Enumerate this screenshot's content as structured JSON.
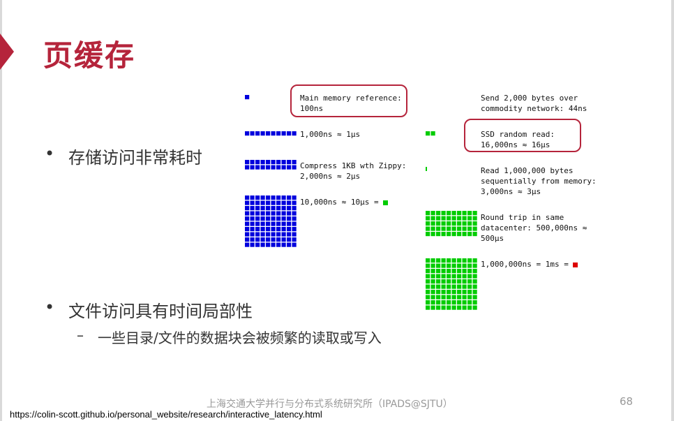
{
  "slide": {
    "title": "页缓存",
    "bullets": [
      {
        "text": "存储访问非常耗时"
      },
      {
        "text": "文件访问具有时间局部性"
      }
    ],
    "sub_bullets": [
      {
        "text": "一些目录/文件的数据块会被频繁的读取或写入"
      }
    ],
    "bullet_marker": "•",
    "dash_marker": "–",
    "footer": "上海交通大学并行与分布式系统研究所（IPADS@SJTU）",
    "page_number": "68",
    "source_url": "https://colin-scott.github.io/personal_website/research/interactive_latency.html"
  },
  "latency": {
    "left_items": [
      {
        "label": "Main memory reference:\n100ns",
        "blue_squares": 1
      },
      {
        "label": "1,000ns ≈ 1μs",
        "blue_squares": 10
      },
      {
        "label": "Compress 1KB wth Zippy:\n2,000ns ≈ 2μs",
        "blue_squares": 20
      },
      {
        "label": "10,000ns ≈ 10μs = ",
        "blue_squares": 100,
        "unit_marker_color": "#00cc00"
      }
    ],
    "right_items": [
      {
        "label": "Send 2,000 bytes over\ncommodity network: 44ns",
        "green_squares": 0
      },
      {
        "label": "SSD random read:\n16,000ns ≈ 16μs",
        "green_squares": 2
      },
      {
        "label": "Read 1,000,000 bytes\nsequentially from memory:\n3,000ns ≈ 3μs",
        "green_squares": 1
      },
      {
        "label": "Round trip in same\ndatacenter: 500,000ns ≈\n500μs",
        "green_squares": 50
      },
      {
        "label": "1,000,000ns = 1ms = ",
        "green_squares": 100,
        "unit_marker_color": "#dd0000"
      }
    ],
    "colors": {
      "blue": "#0000dd",
      "green": "#00cc00",
      "red": "#dd0000",
      "highlight": "#b5243b"
    }
  }
}
